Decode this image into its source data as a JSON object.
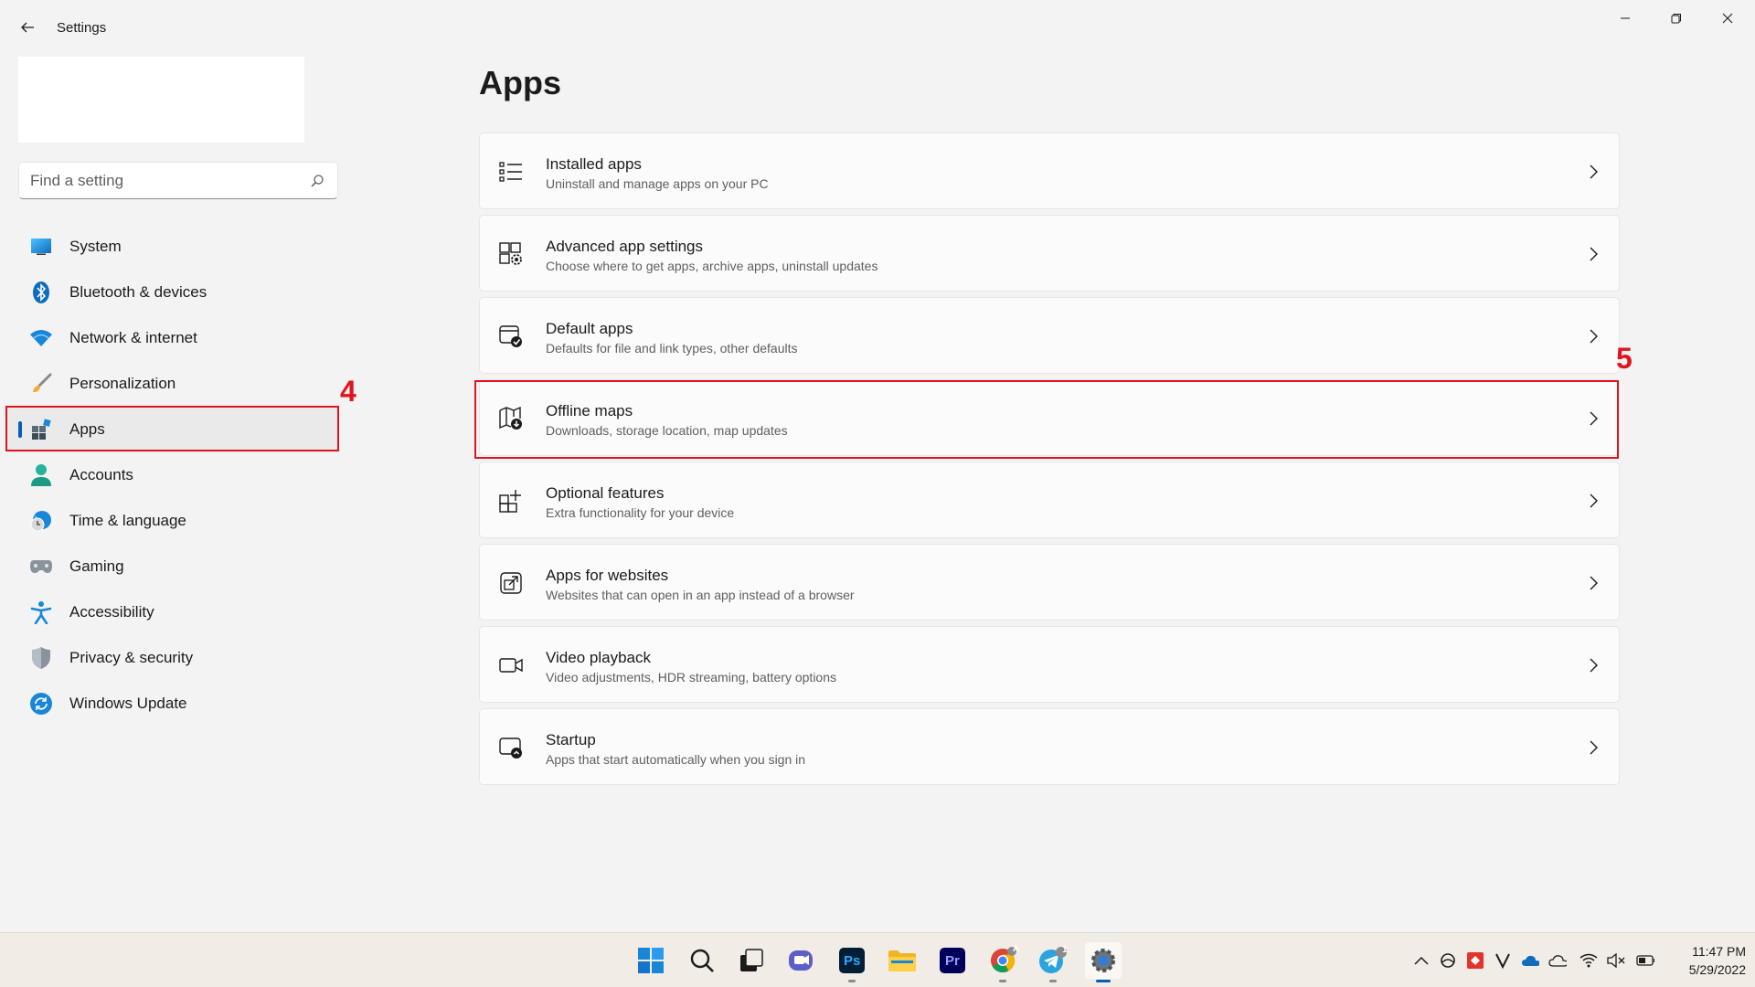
{
  "window": {
    "title": "Settings"
  },
  "search": {
    "placeholder": "Find a setting"
  },
  "sidebar": {
    "items": [
      {
        "label": "System",
        "icon": "system-icon"
      },
      {
        "label": "Bluetooth & devices",
        "icon": "bluetooth-icon"
      },
      {
        "label": "Network & internet",
        "icon": "wifi-icon"
      },
      {
        "label": "Personalization",
        "icon": "brush-icon"
      },
      {
        "label": "Apps",
        "icon": "apps-icon",
        "selected": true
      },
      {
        "label": "Accounts",
        "icon": "person-icon"
      },
      {
        "label": "Time & language",
        "icon": "globe-clock-icon"
      },
      {
        "label": "Gaming",
        "icon": "gamepad-icon"
      },
      {
        "label": "Accessibility",
        "icon": "accessibility-icon"
      },
      {
        "label": "Privacy & security",
        "icon": "shield-icon"
      },
      {
        "label": "Windows Update",
        "icon": "update-icon"
      }
    ]
  },
  "main": {
    "title": "Apps",
    "cards": [
      {
        "title": "Installed apps",
        "subtitle": "Uninstall and manage apps on your PC",
        "icon": "list-icon"
      },
      {
        "title": "Advanced app settings",
        "subtitle": "Choose where to get apps, archive apps, uninstall updates",
        "icon": "app-settings-icon"
      },
      {
        "title": "Default apps",
        "subtitle": "Defaults for file and link types, other defaults",
        "icon": "default-apps-icon"
      },
      {
        "title": "Offline maps",
        "subtitle": "Downloads, storage location, map updates",
        "icon": "map-icon"
      },
      {
        "title": "Optional features",
        "subtitle": "Extra functionality for your device",
        "icon": "add-grid-icon"
      },
      {
        "title": "Apps for websites",
        "subtitle": "Websites that can open in an app instead of a browser",
        "icon": "open-external-icon"
      },
      {
        "title": "Video playback",
        "subtitle": "Video adjustments, HDR streaming, battery options",
        "icon": "video-icon"
      },
      {
        "title": "Startup",
        "subtitle": "Apps that start automatically when you sign in",
        "icon": "startup-icon"
      }
    ]
  },
  "annotations": {
    "step4": "4",
    "step5": "5",
    "color": "#e0141e"
  },
  "taskbar": {
    "apps": [
      "start-icon",
      "search-icon",
      "task-view-icon",
      "teams-chat-icon",
      "photoshop-icon",
      "file-explorer-icon",
      "premiere-icon",
      "chrome-icon",
      "telegram-icon",
      "settings-icon"
    ],
    "photoshop_label": "Ps",
    "premiere_label": "Pr",
    "chrome_badge": "A",
    "telegram_badge": "1",
    "tray": [
      "chevron-up-icon",
      "cloud-sync-icon",
      "anydesk-icon",
      "vivaldi-icon",
      "onedrive-icon",
      "cloud-icon",
      "wifi-icon",
      "volume-muted-icon",
      "battery-icon"
    ],
    "time": "11:47 PM",
    "date": "5/29/2022"
  },
  "colors": {
    "accent": "#005fb8",
    "annotation": "#e0141e",
    "background": "#f3f3f3"
  }
}
